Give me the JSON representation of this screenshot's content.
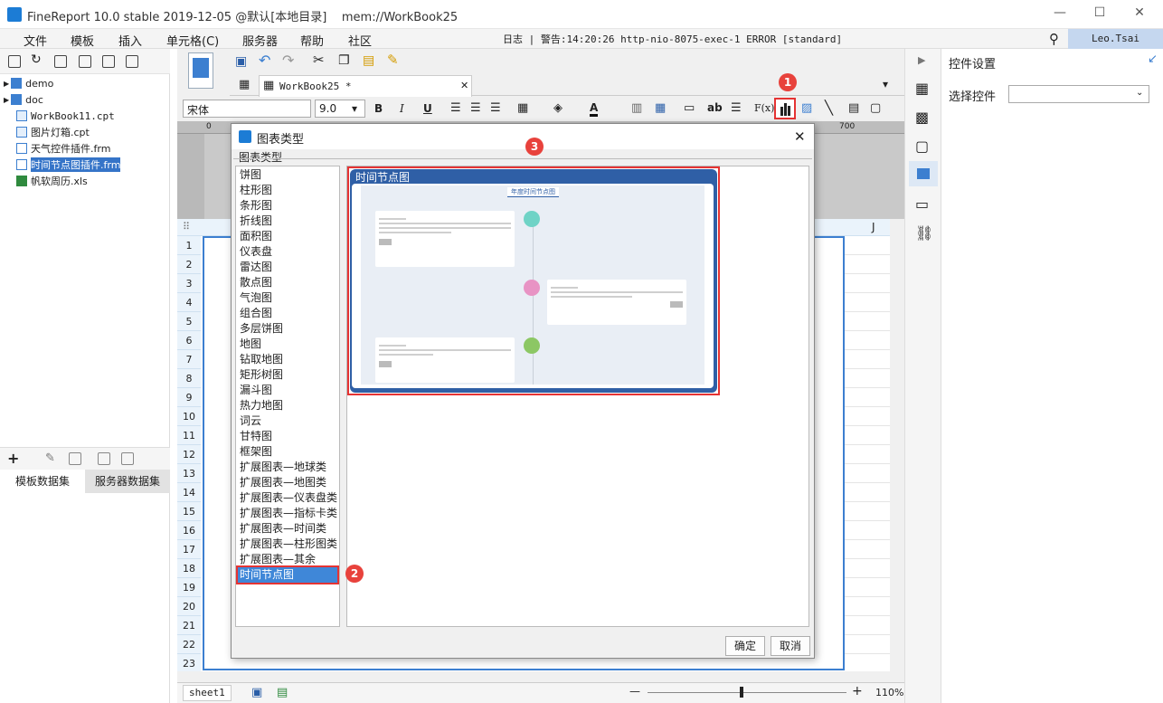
{
  "app": {
    "title": "FineReport 10.0 stable 2019-12-05 @默认[本地目录]",
    "doc": "mem://WorkBook25"
  },
  "menu": [
    "文件",
    "模板",
    "插入",
    "单元格(C)",
    "服务器",
    "帮助",
    "社区"
  ],
  "log": "日志 | 警告:14:20:26 http-nio-8075-exec-1 ERROR [standard]",
  "user": "Leo.Tsai",
  "tree": [
    {
      "label": "demo",
      "type": "folder"
    },
    {
      "label": "doc",
      "type": "folder"
    },
    {
      "label": "WorkBook11.cpt",
      "type": "cpt"
    },
    {
      "label": "图片灯箱.cpt",
      "type": "cpt"
    },
    {
      "label": "天气控件插件.frm",
      "type": "frm"
    },
    {
      "label": "时间节点图插件.frm",
      "type": "frm",
      "selected": true
    },
    {
      "label": "帆软周历.xls",
      "type": "xls"
    }
  ],
  "left_tabs": [
    "模板数据集",
    "服务器数据集"
  ],
  "editor": {
    "tab": "WorkBook25 *",
    "font": "宋体",
    "size": "9.0",
    "ruler_mark": "700",
    "ruler_zero": "0",
    "col_header": "J",
    "rows": [
      "1",
      "2",
      "3",
      "4",
      "5",
      "6",
      "7",
      "8",
      "9",
      "10",
      "11",
      "12",
      "13",
      "14",
      "15",
      "16",
      "17",
      "18",
      "19",
      "20",
      "21",
      "22",
      "23"
    ],
    "sheet": "sheet1",
    "zoom": "110%"
  },
  "format_buttons": {
    "bold": "B",
    "italic": "I",
    "underline": "U",
    "ab": "ab",
    "fx": "F(x)",
    "fontcolor": "A"
  },
  "right": {
    "title": "控件设置",
    "label": "选择控件"
  },
  "dialog": {
    "title": "图表类型",
    "group_label": "图表类型",
    "types": [
      "饼图",
      "柱形图",
      "条形图",
      "折线图",
      "面积图",
      "仪表盘",
      "雷达图",
      "散点图",
      "气泡图",
      "组合图",
      "多层饼图",
      "地图",
      "钻取地图",
      "矩形树图",
      "漏斗图",
      "热力地图",
      "词云",
      "甘特图",
      "框架图",
      "扩展图表—地球类",
      "扩展图表—地图类",
      "扩展图表—仪表盘类",
      "扩展图表—指标卡类",
      "扩展图表—时间类",
      "扩展图表—柱形图类",
      "扩展图表—其余",
      "时间节点图"
    ],
    "selected": "时间节点图",
    "preview_label": "时间节点图",
    "preview_caption": "年度时间节点图",
    "ok": "确定",
    "cancel": "取消"
  },
  "badges": [
    "1",
    "2",
    "3"
  ],
  "colors": {
    "accent": "#3574c8",
    "badge": "#e8423c",
    "highlight": "#e53333"
  }
}
